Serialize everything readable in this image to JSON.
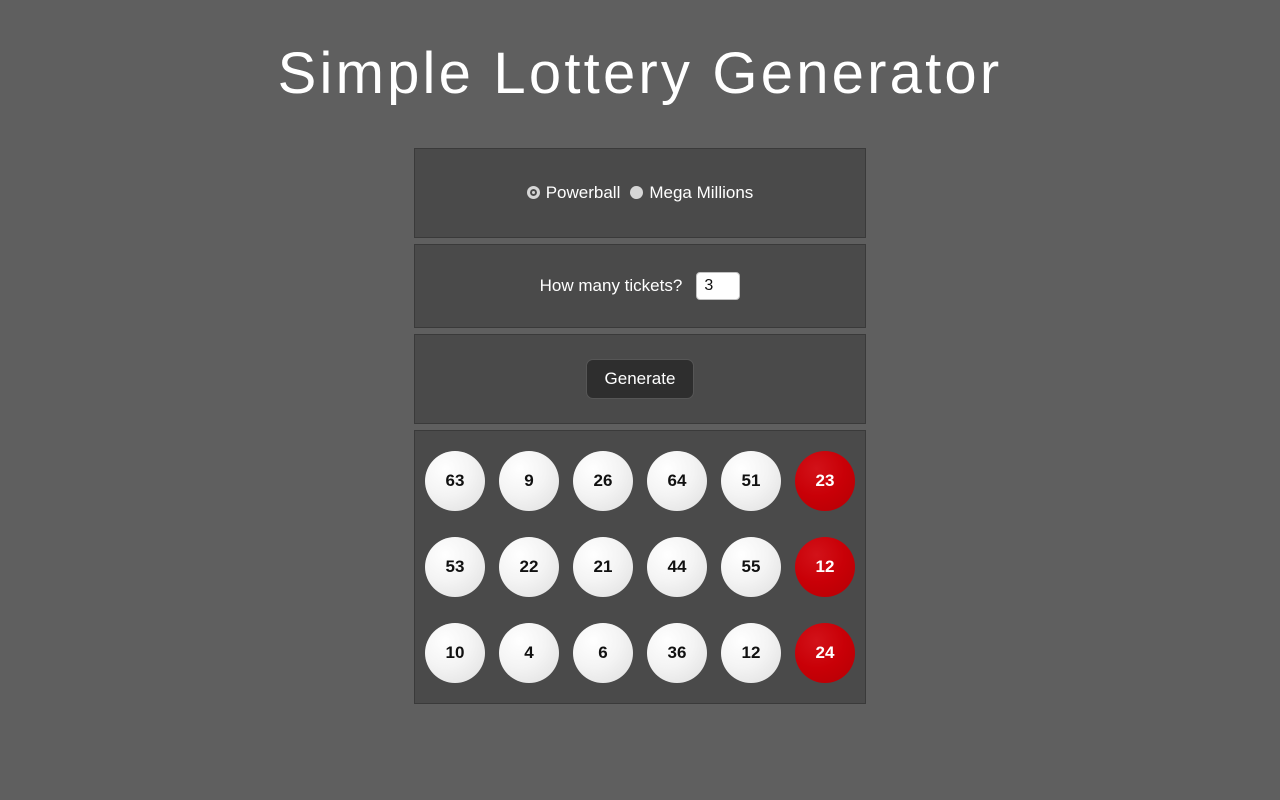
{
  "page": {
    "title": "Simple Lottery Generator",
    "background_color": "#5f5f5f",
    "panel_color": "#4a4a4a",
    "panel_border_color": "#3a3a3a"
  },
  "mode_selector": {
    "options": [
      {
        "label": "Powerball",
        "value": "powerball",
        "selected": true
      },
      {
        "label": "Mega Millions",
        "value": "mega-millions",
        "selected": false
      }
    ]
  },
  "ticket_count": {
    "label": "How many tickets?",
    "value": "3",
    "placeholder": "3"
  },
  "generate": {
    "label": "Generate",
    "button_color": "#2e2e2e"
  },
  "results": {
    "white_ball_color": "#eeeeee",
    "special_ball_color": "#c80005",
    "tickets": [
      {
        "white_balls": [
          "63",
          "9",
          "26",
          "64",
          "51"
        ],
        "special_ball": "23"
      },
      {
        "white_balls": [
          "53",
          "22",
          "21",
          "44",
          "55"
        ],
        "special_ball": "12"
      },
      {
        "white_balls": [
          "10",
          "4",
          "6",
          "36",
          "12"
        ],
        "special_ball": "24"
      }
    ]
  }
}
